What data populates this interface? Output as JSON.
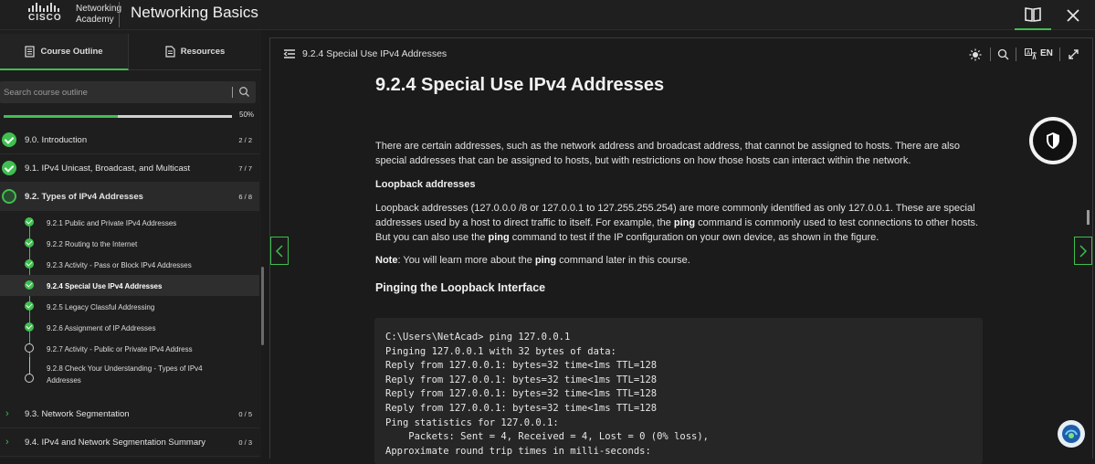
{
  "header": {
    "brand_line1": "Networking",
    "brand_line2": "Academy",
    "brand_cisco": "CISCO",
    "course_title": "Networking Basics",
    "book_icon": "book-open-icon",
    "close_icon": "close-icon"
  },
  "sidebar": {
    "tabs": [
      {
        "label": "Course Outline",
        "icon": "document-list-icon",
        "active": true
      },
      {
        "label": "Resources",
        "icon": "document-icon",
        "active": false
      }
    ],
    "search_placeholder": "Search course outline",
    "progress_fraction": 0.5,
    "progress_label": "50%",
    "sections": [
      {
        "label": "9.0. Introduction",
        "count": "2 / 2",
        "status": "done"
      },
      {
        "label": "9.1. IPv4 Unicast, Broadcast, and Multicast",
        "count": "7 / 7",
        "status": "done"
      },
      {
        "label": "9.2. Types of IPv4 Addresses",
        "count": "6 / 8",
        "status": "partial"
      },
      {
        "label": "9.3. Network Segmentation",
        "count": "0 / 5",
        "status": "collapsed"
      },
      {
        "label": "9.4. IPv4 and Network Segmentation Summary",
        "count": "0 / 3",
        "status": "collapsed"
      }
    ],
    "subitems": [
      {
        "label": "9.2.1 Public and Private IPv4 Addresses",
        "status": "done"
      },
      {
        "label": "9.2.2 Routing to the Internet",
        "status": "done"
      },
      {
        "label": "9.2.3 Activity - Pass or Block IPv4 Addresses",
        "status": "done"
      },
      {
        "label": "9.2.4 Special Use IPv4 Addresses",
        "status": "done"
      },
      {
        "label": "9.2.5 Legacy Classful Addressing",
        "status": "done"
      },
      {
        "label": "9.2.6 Assignment of IP Addresses",
        "status": "done"
      },
      {
        "label": "9.2.7 Activity - Public or Private IPv4 Address",
        "status": "open"
      },
      {
        "label_line1": "9.2.8 Check Your Understanding - Types of IPv4",
        "label_line2": "Addresses",
        "status": "open"
      }
    ]
  },
  "content": {
    "breadcrumb": "9.2.4 Special Use IPv4 Addresses",
    "lang": "EN",
    "title": "9.2.4 Special Use IPv4 Addresses",
    "intro_line1": "There are certain addresses, such as the network address and broadcast address, that cannot be assigned to hosts. There are also",
    "intro_line2": "special addresses that can be assigned to hosts, but with restrictions on how those hosts can interact within the network.",
    "loopback_heading": "Loopback addresses",
    "loopback_line1": "Loopback addresses (127.0.0.0 /8 or 127.0.0.1 to 127.255.255.254) are more commonly identified as only 127.0.0.1. These are special",
    "loopback_line2a": "addresses used by a host to direct traffic to itself. For example, the ",
    "loopback_line2b": "ping",
    "loopback_line2c": " command is commonly used to test connections to other hosts.",
    "loopback_line3a": "But you can also use the ",
    "loopback_line3b": "ping",
    "loopback_line3c": " command to test if the IP configuration on your own device, as shown in the figure.",
    "note_label": "Note",
    "note_a": ": You will learn more about the ",
    "note_b": "ping",
    "note_c": " command later in this course.",
    "figure_title": "Pinging the Loopback Interface",
    "code_lines": [
      "C:\\Users\\NetAcad> ping 127.0.0.1",
      "Pinging 127.0.0.1 with 32 bytes of data:",
      "Reply from 127.0.0.1: bytes=32 time<1ms TTL=128",
      "Reply from 127.0.0.1: bytes=32 time<1ms TTL=128",
      "Reply from 127.0.0.1: bytes=32 time<1ms TTL=128",
      "Reply from 127.0.0.1: bytes=32 time<1ms TTL=128",
      "Ping statistics for 127.0.0.1:",
      "    Packets: Sent = 4, Received = 4, Lost = 0 (0% loss),",
      "Approximate round trip times in milli-seconds:"
    ]
  },
  "colors": {
    "accent": "#3fbf4f",
    "background": "#1b1b1b",
    "panel": "#1e1e1e"
  }
}
